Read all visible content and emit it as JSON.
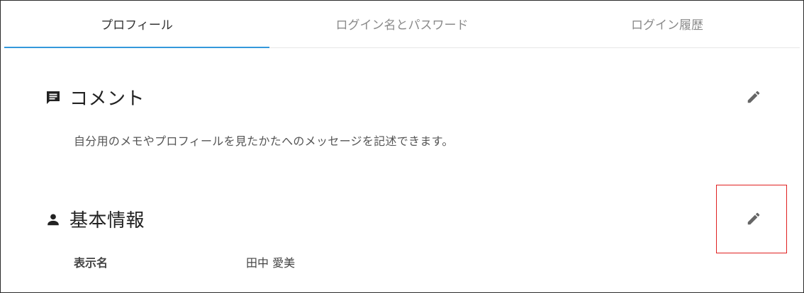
{
  "tabs": [
    {
      "label": "プロフィール",
      "active": true
    },
    {
      "label": "ログイン名とパスワード",
      "active": false
    },
    {
      "label": "ログイン履歴",
      "active": false
    }
  ],
  "comment_section": {
    "title": "コメント",
    "icon": "comment-icon",
    "description": "自分用のメモやプロフィールを見たかたへのメッセージを記述できます。",
    "edit_icon": "pencil-icon"
  },
  "basic_info_section": {
    "title": "基本情報",
    "icon": "person-icon",
    "edit_icon": "pencil-icon",
    "fields": [
      {
        "label": "表示名",
        "value": "田中 愛美"
      }
    ]
  },
  "colors": {
    "tab_indicator": "#3498db",
    "highlight_border": "#e02020"
  }
}
